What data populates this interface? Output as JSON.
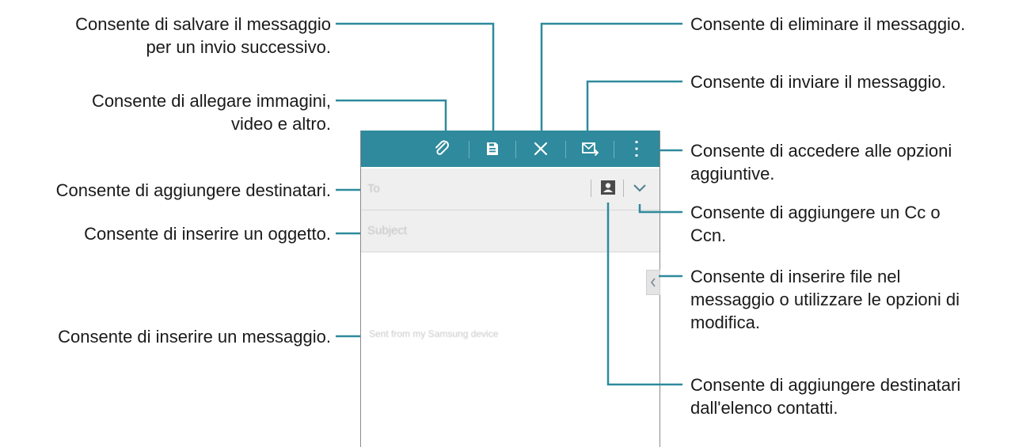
{
  "toolbar": {
    "color": "#2e8a9c",
    "buttons": [
      {
        "name": "attach",
        "icon": "paperclip-icon"
      },
      {
        "name": "save-draft",
        "icon": "floppy-disk-icon"
      },
      {
        "name": "discard",
        "icon": "close-icon"
      },
      {
        "name": "send",
        "icon": "send-mail-icon"
      },
      {
        "name": "more-options",
        "icon": "more-vertical-icon"
      }
    ]
  },
  "compose": {
    "to_placeholder": "To",
    "subject_placeholder": "Subject",
    "signature": "Sent from my Samsung device"
  },
  "callouts": {
    "save": [
      "Consente di salvare il messaggio",
      "per un invio successivo."
    ],
    "attach": [
      "Consente di allegare immagini,",
      "video e altro."
    ],
    "recipients": [
      "Consente di aggiungere destinatari."
    ],
    "subject": [
      "Consente di inserire un oggetto."
    ],
    "message": [
      "Consente di inserire un messaggio."
    ],
    "delete": [
      "Consente di eliminare il messaggio."
    ],
    "send": [
      "Consente di inviare il messaggio."
    ],
    "options": [
      "Consente di accedere alle opzioni",
      "aggiuntive."
    ],
    "cc": [
      "Consente di aggiungere un Cc o",
      "Ccn."
    ],
    "insert": [
      "Consente di inserire file nel",
      "messaggio o utilizzare le opzioni di",
      "modifica."
    ],
    "contacts": [
      "Consente di aggiungere destinatari",
      "dall'elenco contatti."
    ]
  }
}
